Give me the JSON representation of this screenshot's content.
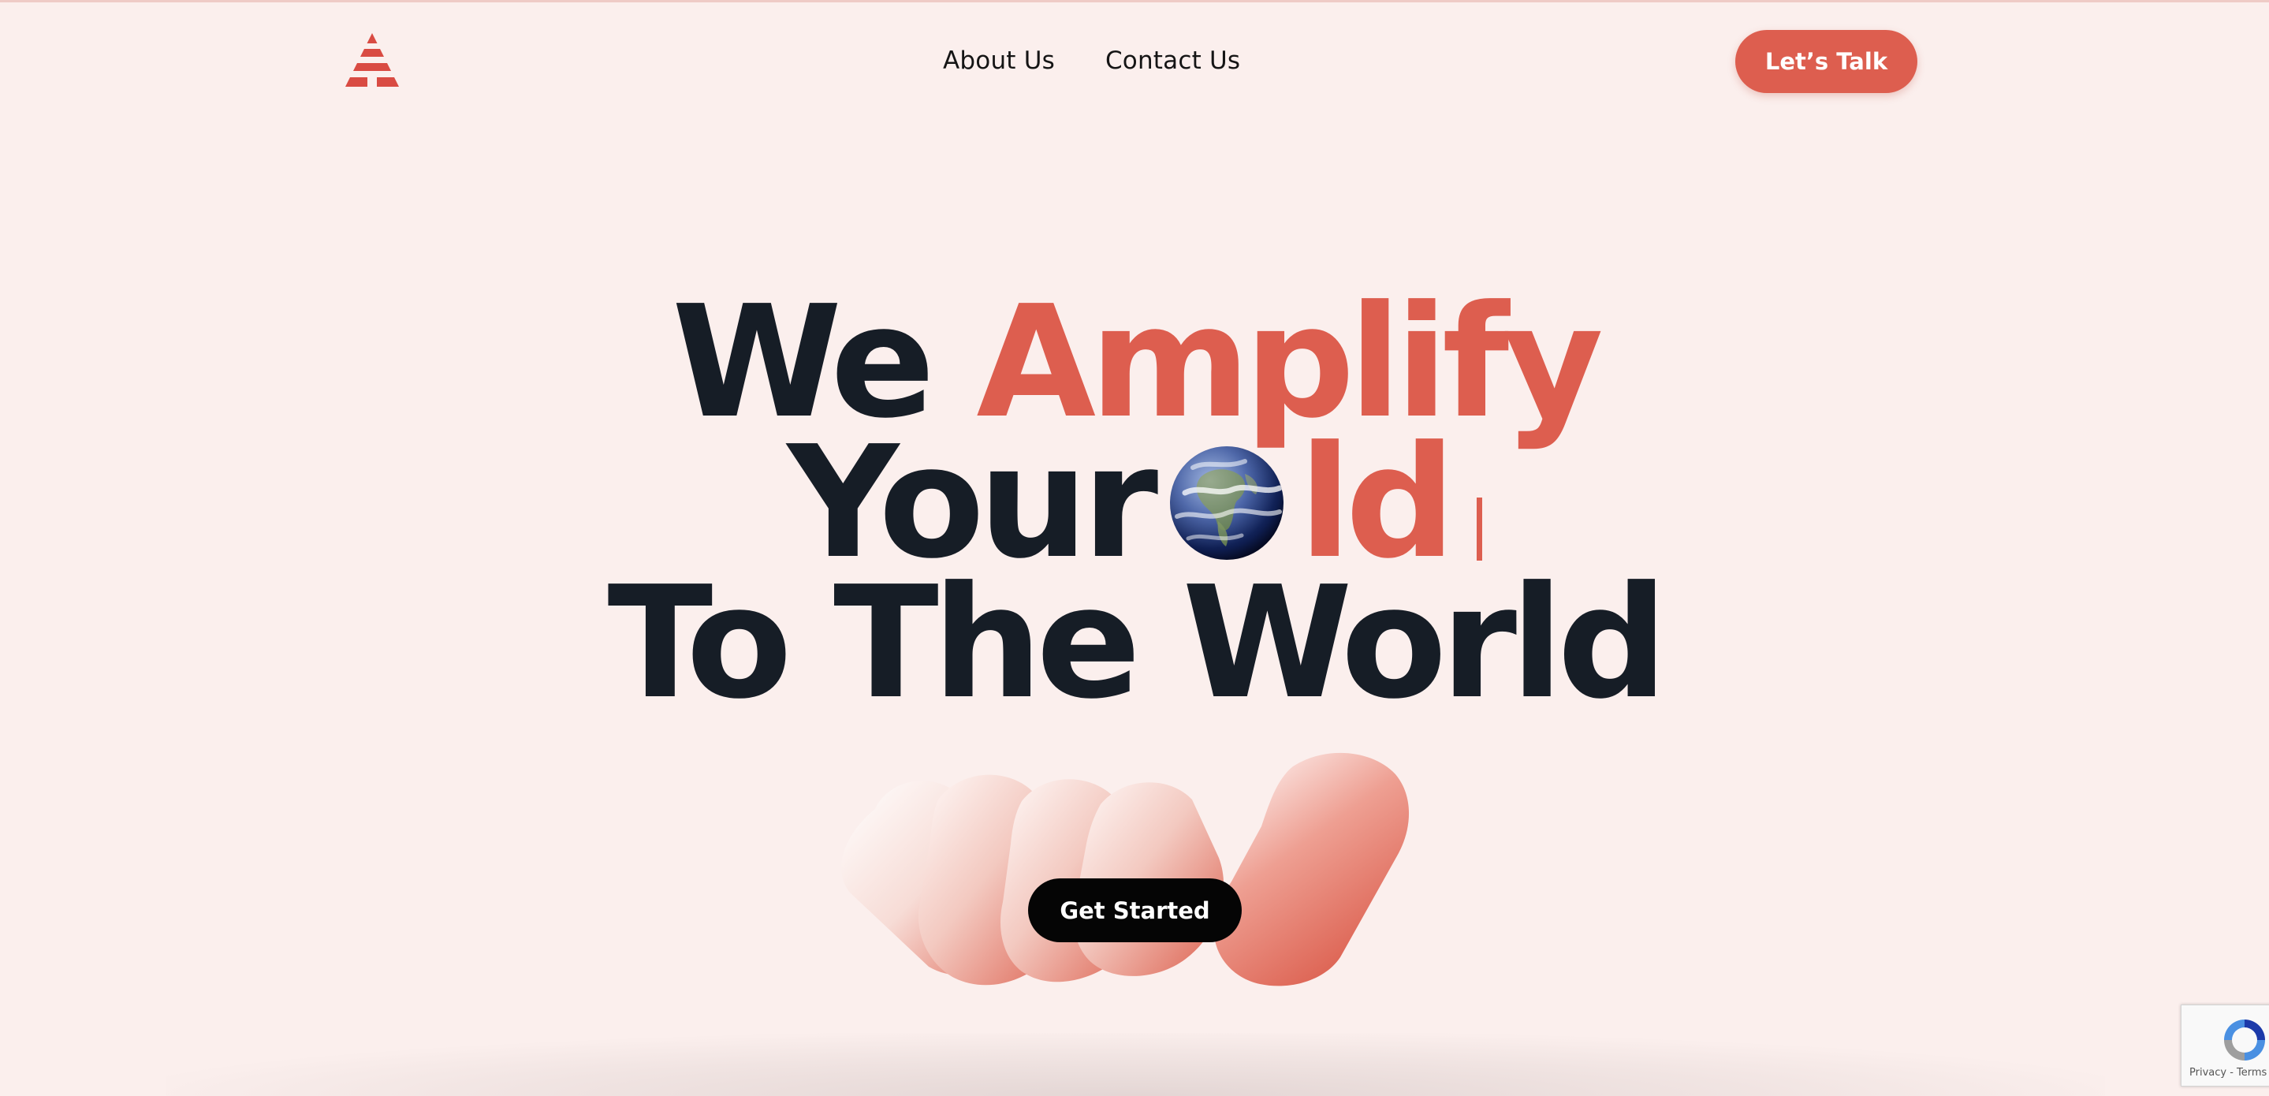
{
  "header": {
    "logo_name": "amplify-logo",
    "nav": [
      {
        "label": "About Us"
      },
      {
        "label": "Contact Us"
      }
    ],
    "cta_label": "Let’s Talk"
  },
  "hero": {
    "line1_dark": "We",
    "line1_accent": "Amplify",
    "line2_dark": "Your",
    "line2_icon": "globe-icon",
    "line2_accent": "ld",
    "line3_dark": "To The World",
    "cta_label": "Get Started"
  },
  "recaptcha": {
    "links": "Privacy - Terms"
  },
  "colors": {
    "background": "#fbefed",
    "accent": "#dd5e4f",
    "heading": "#161d26",
    "button_dark": "#050505"
  }
}
